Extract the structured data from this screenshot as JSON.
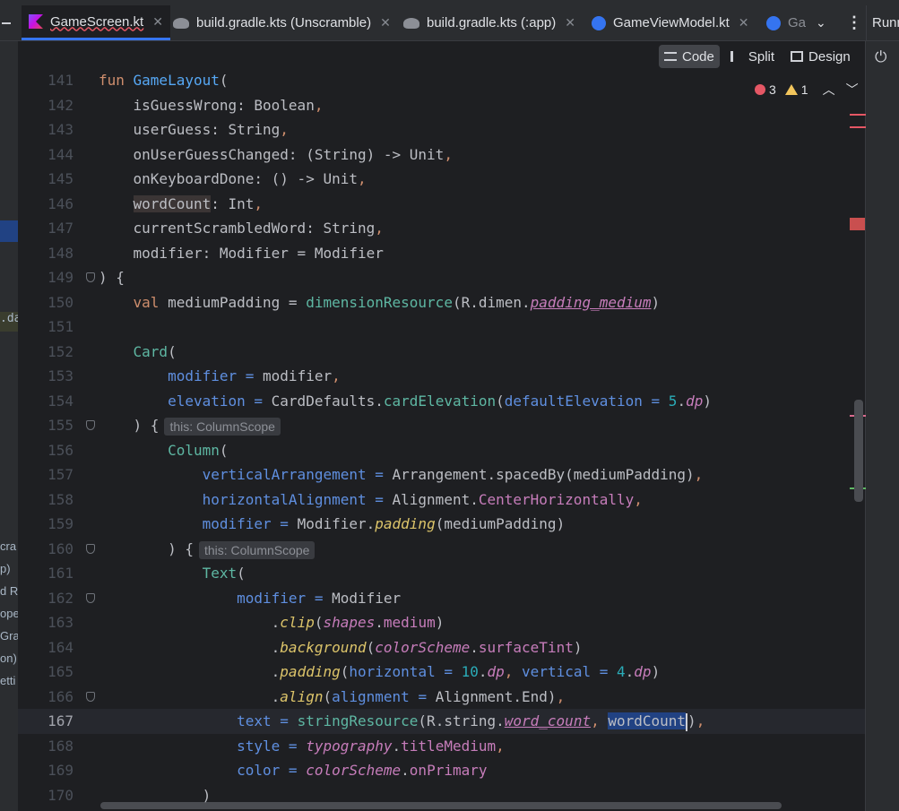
{
  "tabs": [
    {
      "label": "GameScreen.kt",
      "icon": "kotlin-file-icon",
      "active": true
    },
    {
      "label": "build.gradle.kts (Unscramble)",
      "icon": "gradle-icon",
      "active": false
    },
    {
      "label": "build.gradle.kts (:app)",
      "icon": "gradle-icon",
      "active": false
    },
    {
      "label": "GameViewModel.kt",
      "icon": "kotlin-class-icon",
      "active": false
    },
    {
      "label": "Ga",
      "icon": "kotlin-class-icon",
      "active": false
    }
  ],
  "right_tab_label": "Runn",
  "view_modes": {
    "code": "Code",
    "split": "Split",
    "design": "Design"
  },
  "inspection": {
    "errors": "3",
    "warnings": "1"
  },
  "left_fragments": [
    ".da",
    "cra",
    "p)",
    "d R",
    "ope",
    "Grad",
    "on)",
    "etti"
  ],
  "hints": {
    "column_scope": "this: ColumnScope"
  },
  "code_lines": [
    {
      "n": "141",
      "t": "fun GameLayout("
    },
    {
      "n": "142",
      "t": "    isGuessWrong: Boolean,"
    },
    {
      "n": "143",
      "t": "    userGuess: String,"
    },
    {
      "n": "144",
      "t": "    onUserGuessChanged: (String) -> Unit,"
    },
    {
      "n": "145",
      "t": "    onKeyboardDone: () -> Unit,"
    },
    {
      "n": "146",
      "t": "    wordCount: Int,"
    },
    {
      "n": "147",
      "t": "    currentScrambledWord: String,"
    },
    {
      "n": "148",
      "t": "    modifier: Modifier = Modifier"
    },
    {
      "n": "149",
      "t": ") {"
    },
    {
      "n": "150",
      "t": "    val mediumPadding = dimensionResource(R.dimen.padding_medium)"
    },
    {
      "n": "151",
      "t": ""
    },
    {
      "n": "152",
      "t": "    Card("
    },
    {
      "n": "153",
      "t": "        modifier = modifier,"
    },
    {
      "n": "154",
      "t": "        elevation = CardDefaults.cardElevation(defaultElevation = 5.dp)"
    },
    {
      "n": "155",
      "t": "    ) {"
    },
    {
      "n": "156",
      "t": "        Column("
    },
    {
      "n": "157",
      "t": "            verticalArrangement = Arrangement.spacedBy(mediumPadding),"
    },
    {
      "n": "158",
      "t": "            horizontalAlignment = Alignment.CenterHorizontally,"
    },
    {
      "n": "159",
      "t": "            modifier = Modifier.padding(mediumPadding)"
    },
    {
      "n": "160",
      "t": "        ) {"
    },
    {
      "n": "161",
      "t": "            Text("
    },
    {
      "n": "162",
      "t": "                modifier = Modifier"
    },
    {
      "n": "163",
      "t": "                    .clip(shapes.medium)"
    },
    {
      "n": "164",
      "t": "                    .background(colorScheme.surfaceTint)"
    },
    {
      "n": "165",
      "t": "                    .padding(horizontal = 10.dp, vertical = 4.dp)"
    },
    {
      "n": "166",
      "t": "                    .align(alignment = Alignment.End),"
    },
    {
      "n": "167",
      "t": "                text = stringResource(R.string.word_count, wordCount),"
    },
    {
      "n": "168",
      "t": "                style = typography.titleMedium,"
    },
    {
      "n": "169",
      "t": "                color = colorScheme.onPrimary"
    },
    {
      "n": "170",
      "t": "            )"
    }
  ],
  "colors": {
    "accent": "#3574f0",
    "error": "#e55765",
    "warning": "#f2c55c",
    "background": "#1e1f22"
  }
}
